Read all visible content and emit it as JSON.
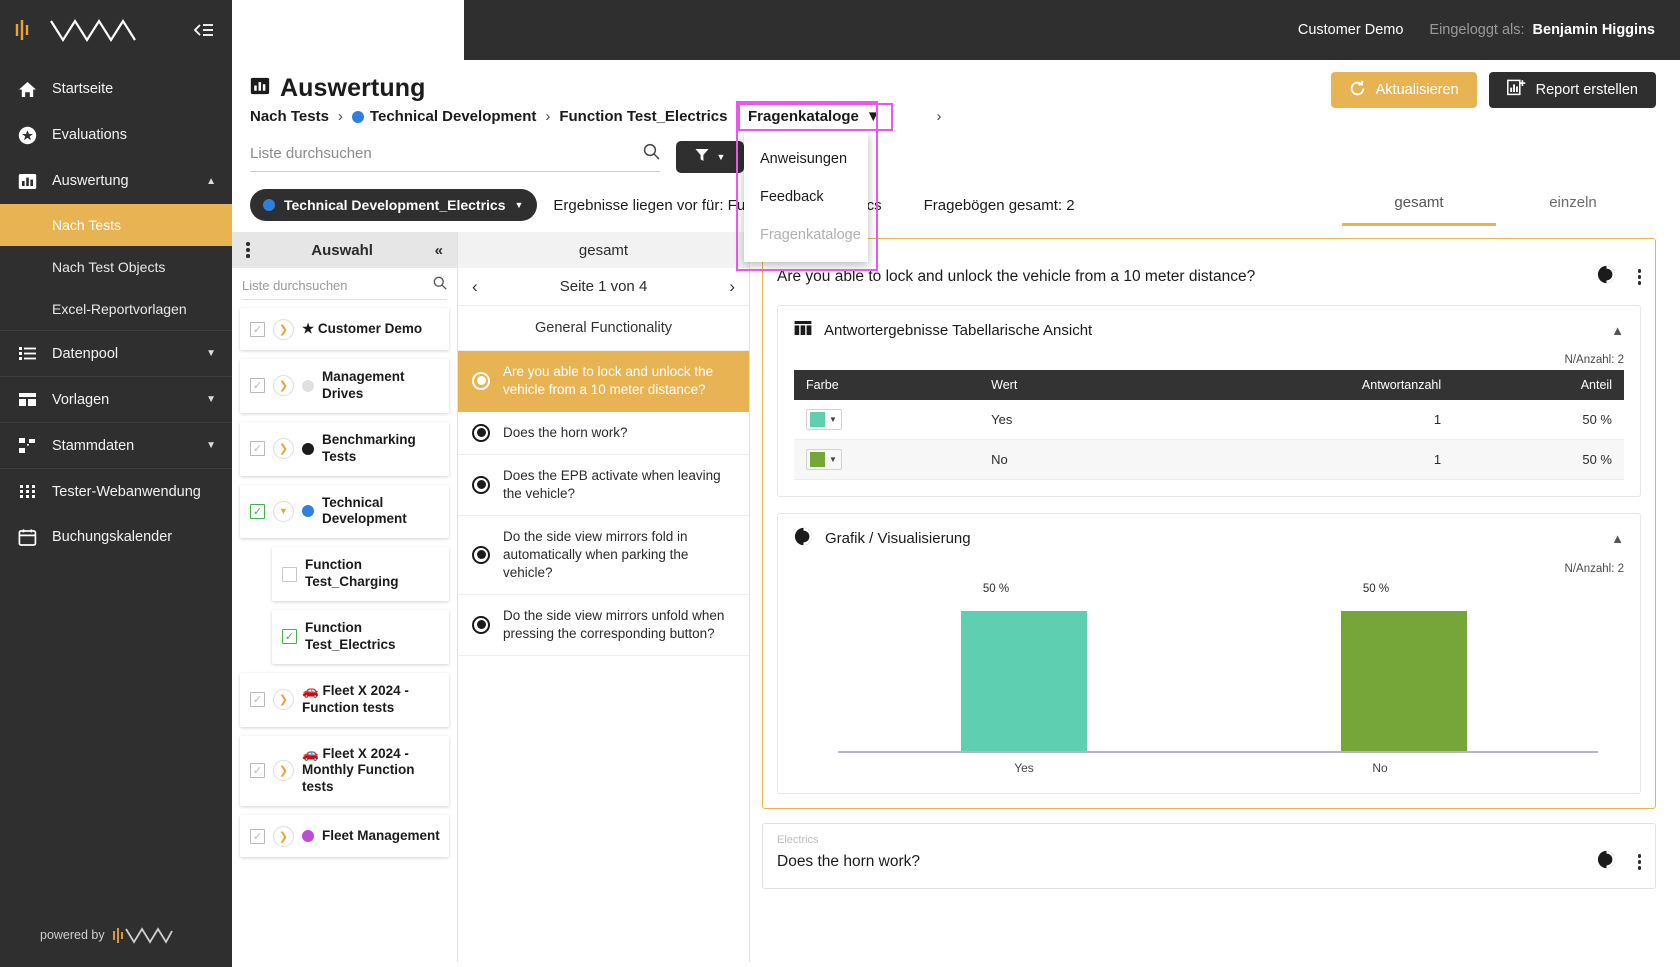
{
  "topbar": {
    "org": "Customer Demo",
    "logged_in_label": "Eingeloggt als:",
    "user": "Benjamin Higgins",
    "icons": [
      "mail-icon",
      "logout-icon",
      "globe-icon",
      "help-icon"
    ]
  },
  "sidebar": {
    "brand": "waveform-logo",
    "collapse_icon": "collapse-sidebar-icon",
    "items": [
      {
        "label": "Startseite",
        "icon": "home-icon",
        "expandable": false
      },
      {
        "label": "Evaluations",
        "icon": "star-circle-icon",
        "expandable": false
      },
      {
        "label": "Auswertung",
        "icon": "bar-chart-icon",
        "expandable": true,
        "expanded": true
      },
      {
        "label": "Datenpool",
        "icon": "database-list-icon",
        "expandable": true,
        "expanded": false
      },
      {
        "label": "Vorlagen",
        "icon": "layout-icon",
        "expandable": true,
        "expanded": false
      },
      {
        "label": "Stammdaten",
        "icon": "hierarchy-icon",
        "expandable": true,
        "expanded": false
      },
      {
        "label": "Tester-Webanwendung",
        "icon": "grid-dots-icon",
        "expandable": false
      },
      {
        "label": "Buchungskalender",
        "icon": "calendar-icon",
        "expandable": false
      }
    ],
    "sub_items": [
      {
        "label": "Nach Tests",
        "active": true
      },
      {
        "label": "Nach Test Objects",
        "active": false
      },
      {
        "label": "Excel-Reportvorlagen",
        "active": false
      }
    ],
    "powered_by": "powered by"
  },
  "page": {
    "title": "Auswertung",
    "title_icon": "bar-chart-icon",
    "breadcrumb": [
      {
        "label": "Nach Tests",
        "dot": null
      },
      {
        "label": "Technical Development",
        "dot": "#2f7fe0"
      },
      {
        "label": "Function Test_Electrics",
        "dot": null
      }
    ],
    "breadcrumb_dropdown": {
      "label": "Fragenkataloge",
      "highlight_color": "#ee55ee",
      "options": [
        {
          "label": "Anweisungen",
          "disabled": false
        },
        {
          "label": "Feedback",
          "disabled": false
        },
        {
          "label": "Fragenkataloge",
          "disabled": true
        }
      ]
    },
    "actions": {
      "refresh_label": "Aktualisieren",
      "refresh_icon": "refresh-icon",
      "report_label": "Report erstellen",
      "report_icon": "chart-plus-icon"
    },
    "search_placeholder": "Liste durchsuchen",
    "search_value": "",
    "search_icon": "search-icon",
    "filter_icon": "filter-icon",
    "scope_pill": {
      "label": "Technical Development_Electrics",
      "dot": "#2f7fe0"
    },
    "results_label": "Ergebnisse liegen vor für: Function Test_Electrics",
    "questionnaires_total": "Fragebögen gesamt: 2",
    "tabs": [
      {
        "label": "gesamt",
        "active": true
      },
      {
        "label": "einzeln",
        "active": false
      }
    ]
  },
  "selection_panel": {
    "title": "Auswahl",
    "kebab_icon": "kebab-menu-icon",
    "collapse_icon": "double-chevron-left-icon",
    "search_placeholder": "Liste durchsuchen",
    "search_value": "",
    "nodes": [
      {
        "label": "★ Customer Demo",
        "checkbox": "indeterminate",
        "caret": "right",
        "child": false
      },
      {
        "label": "Management Drives",
        "checkbox": "indeterminate",
        "caret": "right",
        "child": false,
        "dot": "#e0e0e0"
      },
      {
        "label": "Benchmarking Tests",
        "checkbox": "indeterminate",
        "caret": "right",
        "child": false,
        "dot": "#1b1b1b"
      },
      {
        "label": "Technical Development",
        "checkbox": "checked",
        "caret": "down",
        "child": false,
        "dot": "#2f7fe0"
      },
      {
        "label": "Function Test_Charging",
        "checkbox": "empty",
        "caret": null,
        "child": true
      },
      {
        "label": "Function Test_Electrics",
        "checkbox": "checked",
        "caret": null,
        "child": true
      },
      {
        "label": "🚗 Fleet X 2024 - Function tests",
        "checkbox": "indeterminate",
        "caret": "right",
        "child": false
      },
      {
        "label": "🚗 Fleet X 2024 - Monthly Function tests",
        "checkbox": "indeterminate",
        "caret": "right",
        "child": false
      },
      {
        "label": "Fleet Management",
        "checkbox": "indeterminate",
        "caret": "right",
        "child": false,
        "dot": "#c04ad8"
      }
    ]
  },
  "question_list": {
    "header": "gesamt",
    "pager": {
      "text": "Seite 1 von 4",
      "prev_icon": "chevron-left-icon",
      "next_icon": "chevron-right-icon"
    },
    "group_title": "General Functionality",
    "questions": [
      {
        "text": "Are you able to lock and unlock the vehicle from a 10 meter distance?",
        "active": true
      },
      {
        "text": "Does the horn work?",
        "active": false
      },
      {
        "text": "Does the EPB activate when leaving the vehicle?",
        "active": false
      },
      {
        "text": "Do the side view mirrors fold in automatically when parking the vehicle?",
        "active": false
      },
      {
        "text": "Do the side view mirrors unfold when pressing the corresponding button?",
        "active": false
      }
    ]
  },
  "detail": {
    "cards": [
      {
        "category": "Electrics",
        "question": "Are you able to lock and unlock the vehicle from a 10 meter distance?",
        "chart_icon": "pie-chart-icon",
        "kebab_icon": "kebab-menu-icon",
        "table_panel": {
          "title": "Antwortergebnisse Tabellarische Ansicht",
          "icon": "table-icon",
          "collapse_icon": "chevron-up-icon",
          "n_label": "N/Anzahl: 2",
          "columns": [
            "Farbe",
            "Wert",
            "Antwortanzahl",
            "Anteil"
          ],
          "rows": [
            {
              "color": "#5ECFB1",
              "value": "Yes",
              "count": "1",
              "share": "50 %"
            },
            {
              "color": "#76A53A",
              "value": "No",
              "count": "1",
              "share": "50 %"
            }
          ]
        },
        "chart_panel": {
          "title": "Grafik / Visualisierung",
          "icon": "pie-chart-icon",
          "collapse_icon": "chevron-up-icon",
          "n_label": "N/Anzahl: 2"
        }
      },
      {
        "category": "Electrics",
        "question": "Does the horn work?",
        "chart_icon": "pie-chart-icon",
        "kebab_icon": "kebab-menu-icon"
      }
    ]
  },
  "chart_data": {
    "type": "bar",
    "title": "Grafik / Visualisierung",
    "categories": [
      "Yes",
      "No"
    ],
    "values": [
      50,
      50
    ],
    "value_labels": [
      "50 %",
      "50 %"
    ],
    "colors": [
      "#5ECFB1",
      "#76A53A"
    ],
    "ylabel": "",
    "xlabel": "",
    "ylim": [
      0,
      60
    ],
    "grid": false,
    "legend": "none",
    "annotation": "N/Anzahl: 2"
  }
}
